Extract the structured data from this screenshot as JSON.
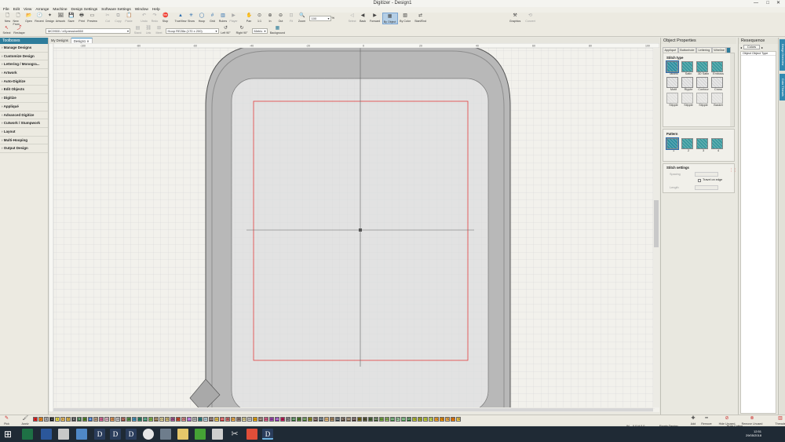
{
  "window": {
    "title": "Digitizer - Design1"
  },
  "menu": [
    "File",
    "Edit",
    "View",
    "Arrange",
    "Machine",
    "Design Settings",
    "Software Settings",
    "Window",
    "Help"
  ],
  "toolbar": {
    "buttons": [
      {
        "label": "New",
        "icon": "new-icon",
        "enabled": true
      },
      {
        "label": "New From",
        "icon": "new-from-icon",
        "enabled": true
      },
      {
        "label": "Open",
        "icon": "open-icon",
        "enabled": true
      },
      {
        "label": "Recent",
        "icon": "recent-icon",
        "enabled": true
      },
      {
        "label": "Design",
        "icon": "design-icon",
        "enabled": true
      },
      {
        "label": "Artwork",
        "icon": "artwork-icon",
        "enabled": true
      },
      {
        "label": "Save",
        "icon": "save-icon",
        "enabled": true
      },
      {
        "label": "Print",
        "icon": "print-icon",
        "enabled": true
      },
      {
        "label": "Preview",
        "icon": "preview-icon",
        "enabled": true
      },
      {
        "label": "Cut",
        "icon": "cut-icon",
        "enabled": false
      },
      {
        "label": "Copy",
        "icon": "copy-icon",
        "enabled": false
      },
      {
        "label": "Paste",
        "icon": "paste-icon",
        "enabled": false
      },
      {
        "label": "Undo",
        "icon": "undo-icon",
        "enabled": false
      },
      {
        "label": "Redo",
        "icon": "redo-icon",
        "enabled": false
      },
      {
        "label": "Stop",
        "icon": "stop-icon",
        "enabled": true
      },
      {
        "label": "TrueView",
        "icon": "trueview-icon",
        "enabled": true
      },
      {
        "label": "Show",
        "icon": "show-icon",
        "enabled": true
      },
      {
        "label": "Hoop",
        "icon": "hoop-icon",
        "enabled": true
      },
      {
        "label": "Grid",
        "icon": "grid-icon",
        "enabled": true
      },
      {
        "label": "Rulers",
        "icon": "rulers-icon",
        "enabled": true
      },
      {
        "label": "Player",
        "icon": "player-icon",
        "enabled": false
      },
      {
        "label": "Pan",
        "icon": "pan-icon",
        "enabled": true
      },
      {
        "label": "1:1",
        "icon": "actual-size-icon",
        "enabled": true
      },
      {
        "label": "In",
        "icon": "zoom-in-icon",
        "enabled": true
      },
      {
        "label": "Out",
        "icon": "zoom-out-icon",
        "enabled": true
      },
      {
        "label": "Fit",
        "icon": "fit-icon",
        "enabled": false
      },
      {
        "label": "Zoom",
        "icon": "zoom-icon",
        "enabled": true
      }
    ],
    "zoom_value": "100",
    "zoom_unit": "%",
    "right_buttons": [
      {
        "label": "Select",
        "icon": "select-icon",
        "enabled": false
      },
      {
        "label": "Back",
        "icon": "back-icon",
        "enabled": true
      },
      {
        "label": "Forward",
        "icon": "forward-icon",
        "enabled": true
      },
      {
        "label": "By Object",
        "icon": "by-object-icon",
        "enabled": true,
        "selected": true
      },
      {
        "label": "By Color",
        "icon": "by-color-icon",
        "enabled": true
      },
      {
        "label": "Start/End",
        "icon": "start-end-icon",
        "enabled": true
      }
    ],
    "far_right": [
      {
        "label": "Graphics",
        "icon": "graphics-icon",
        "enabled": true
      },
      {
        "label": "Convert",
        "icon": "convert-icon",
        "enabled": false
      }
    ]
  },
  "toolbar2": {
    "select_label": "Select",
    "reshape_label": "Reshape",
    "machine": "MC9900 / eXpressive860",
    "small_buttons": [
      "Stand",
      "Link",
      "Meet"
    ],
    "hoop": "Hoop RE28a (170 x 200)",
    "left90": "Left 90°",
    "right90": "Right 90°",
    "units": "Metric",
    "background": "Background"
  },
  "leftpanel": {
    "title": "Toolboxes",
    "items": [
      "Manage Designs",
      "Customize Design",
      "Lettering / Monogra...",
      "Artwork",
      "Auto-Digitize",
      "Edit Objects",
      "Digitize",
      "Appliqué",
      "Advanced Digitize",
      "Cutwork / Stumpwork",
      "Layout",
      "Multi-Hooping",
      "Output Design"
    ]
  },
  "doctabs": [
    "My Designs",
    "Design1"
  ],
  "ruler": {
    "marks": [
      "-100",
      "-80",
      "-60",
      "-40",
      "-20",
      "0",
      "20",
      "40",
      "60",
      "80",
      "100"
    ]
  },
  "object_properties": {
    "title": "Object Properties",
    "tabs": [
      "Appliqué",
      "Buttonhole",
      "Lettering",
      "Wireline"
    ],
    "stitch_type_label": "Stitch type",
    "stitch_types": [
      "Tatami",
      "Satin",
      "3D Satin",
      "Emboss",
      "Motif",
      "Ripple",
      "Contour",
      "Cross",
      "Stipple",
      "Stipple",
      "Stipple",
      "Basket"
    ],
    "pattern_label": "Pattern",
    "patterns": [
      "1",
      "2",
      "3",
      "4"
    ],
    "stitch_settings_label": "Stitch settings",
    "spacing_label": "Spacing",
    "travel_on_edge": "Travel on edge",
    "length_label": "Length"
  },
  "resequence": {
    "title": "Resequence",
    "colors_button": "Colors",
    "column_header": "Object   Object Type"
  },
  "vtabs": [
    "Design Overview",
    "Color Threads"
  ],
  "palette": {
    "pick_label": "Pick",
    "apply_label": "Apply",
    "colors": [
      {
        "n": "1",
        "c": "#e22121"
      },
      {
        "n": "2",
        "c": "#f28a1a"
      },
      {
        "n": "3",
        "c": "#b0b0b0"
      },
      {
        "n": "4",
        "c": "#111111"
      },
      {
        "n": "5",
        "c": "#f7e64a"
      },
      {
        "n": "6",
        "c": "#f4c35f"
      },
      {
        "n": "7",
        "c": "#d8b24a"
      },
      {
        "n": "8",
        "c": "#3a3a3a"
      },
      {
        "n": "9",
        "c": "#2f6c3e"
      },
      {
        "n": "10",
        "c": "#5a8f2a"
      },
      {
        "n": "11",
        "c": "#2a64b8"
      },
      {
        "n": "12",
        "c": "#c7a98a"
      },
      {
        "n": "13",
        "c": "#e86da0"
      },
      {
        "n": "14",
        "c": "#f0c0d0"
      },
      {
        "n": "15",
        "c": "#f5a25a"
      },
      {
        "n": "16",
        "c": "#d9d9d9"
      },
      {
        "n": "17",
        "c": "#8a3c2c"
      },
      {
        "n": "18",
        "c": "#5f9e4d"
      },
      {
        "n": "19",
        "c": "#4ca3cf"
      },
      {
        "n": "20",
        "c": "#2e8f6b"
      },
      {
        "n": "21",
        "c": "#1f7a56"
      },
      {
        "n": "22",
        "c": "#8bc34a"
      },
      {
        "n": "23",
        "c": "#7a5a2a"
      },
      {
        "n": "24",
        "c": "#f0e0a0"
      },
      {
        "n": "25",
        "c": "#e8d080"
      },
      {
        "n": "26",
        "c": "#b25a9c"
      },
      {
        "n": "27",
        "c": "#d44c2e"
      },
      {
        "n": "28",
        "c": "#f09090"
      },
      {
        "n": "29",
        "c": "#9c4dcc"
      },
      {
        "n": "30",
        "c": "#c9c9c9"
      },
      {
        "n": "31",
        "c": "#2d8c8c"
      },
      {
        "n": "32",
        "c": "#c8e6f2"
      },
      {
        "n": "33",
        "c": "#5d4037"
      },
      {
        "n": "34",
        "c": "#ffd54f"
      },
      {
        "n": "35",
        "c": "#c62828"
      },
      {
        "n": "36",
        "c": "#e57373"
      },
      {
        "n": "37",
        "c": "#ffb74d"
      },
      {
        "n": "38",
        "c": "#a1887f"
      },
      {
        "n": "39",
        "c": "#f8e9a1"
      },
      {
        "n": "40",
        "c": "#dcdcdc"
      },
      {
        "n": "41",
        "c": "#ffb300"
      },
      {
        "n": "42",
        "c": "#6d4c41"
      },
      {
        "n": "43",
        "c": "#f06292"
      },
      {
        "n": "44",
        "c": "#ab47bc"
      },
      {
        "n": "45",
        "c": "#7b1fa2"
      },
      {
        "n": "46",
        "c": "#d81b60"
      },
      {
        "n": "47",
        "c": "#8e8e8e"
      },
      {
        "n": "48",
        "c": "#1b5e20"
      },
      {
        "n": "49",
        "c": "#558b2f"
      },
      {
        "n": "50",
        "c": "#33691e"
      },
      {
        "n": "51",
        "c": "#9e9d24"
      },
      {
        "n": "52",
        "c": "#4e342e"
      },
      {
        "n": "53",
        "c": "#37474f"
      },
      {
        "n": "54",
        "c": "#ffcc80"
      },
      {
        "n": "55",
        "c": "#bf9a6b"
      },
      {
        "n": "56",
        "c": "#263238"
      },
      {
        "n": "57",
        "c": "#4a3728"
      },
      {
        "n": "58",
        "c": "#6b5433"
      },
      {
        "n": "59",
        "c": "#3e2723"
      },
      {
        "n": "60",
        "c": "#827717"
      },
      {
        "n": "61",
        "c": "#5d5d3b"
      },
      {
        "n": "62",
        "c": "#4f6f3a"
      },
      {
        "n": "63",
        "c": "#2e4e1e"
      },
      {
        "n": "64",
        "c": "#7cb342"
      },
      {
        "n": "65",
        "c": "#9ccc65"
      },
      {
        "n": "66",
        "c": "#2e7d32"
      },
      {
        "n": "67",
        "c": "#a5d6a7"
      },
      {
        "n": "68",
        "c": "#388e3c"
      },
      {
        "n": "69",
        "c": "#1b5e20"
      },
      {
        "n": "70",
        "c": "#c0ca33"
      },
      {
        "n": "71",
        "c": "#afb42b"
      },
      {
        "n": "72",
        "c": "#cddc39"
      },
      {
        "n": "73",
        "c": "#d4e157"
      },
      {
        "n": "74",
        "c": "#ffa726"
      },
      {
        "n": "75",
        "c": "#ff9800"
      },
      {
        "n": "76",
        "c": "#ffb74d"
      },
      {
        "n": "77",
        "c": "#f57c00"
      },
      {
        "n": "78",
        "c": "#ffd54f"
      }
    ],
    "right_buttons": [
      "Add",
      "Remove",
      "Hide Unused",
      "Remove Unused",
      "Threads"
    ]
  },
  "status": {
    "w": "W",
    "coords": "0.0 H   0.0",
    "state": "Empty Design",
    "fabric": "Pure Cotton"
  },
  "taskbar": {
    "time": "12:51",
    "date": "29/05/2018"
  },
  "accent": "#2e7d9b",
  "hoop_color": "#b8b8b8"
}
